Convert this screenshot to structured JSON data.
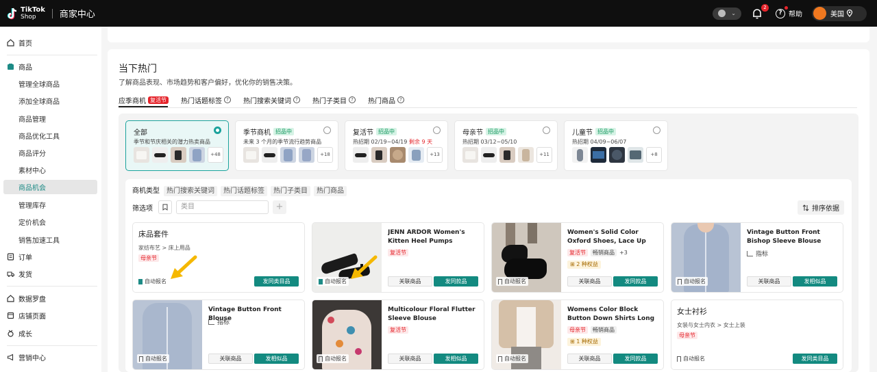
{
  "header": {
    "logo_line1": "TikTok",
    "logo_line2": "Shop",
    "title": "商家中心",
    "notification_count": "2",
    "help_label": "帮助",
    "region_label": "美国"
  },
  "sidebar": {
    "items": [
      {
        "label": "首页",
        "icon": "home-icon"
      },
      {
        "label": "商品",
        "icon": "product-icon"
      },
      {
        "label": "管理全球商品"
      },
      {
        "label": "添加全球商品"
      },
      {
        "label": "商品管理"
      },
      {
        "label": "商品优化工具"
      },
      {
        "label": "商品评分"
      },
      {
        "label": "素材中心"
      },
      {
        "label": "商品机会"
      },
      {
        "label": "管理库存"
      },
      {
        "label": "定价机会"
      },
      {
        "label": "销售加速工具"
      },
      {
        "label": "订单",
        "icon": "order-icon"
      },
      {
        "label": "发货",
        "icon": "truck-icon"
      },
      {
        "label": "数据罗盘",
        "icon": "compass-icon"
      },
      {
        "label": "店铺页面",
        "icon": "store-icon"
      },
      {
        "label": "成长",
        "icon": "growth-icon"
      },
      {
        "label": "营销中心",
        "icon": "megaphone-icon"
      }
    ]
  },
  "page": {
    "title": "当下热门",
    "subtitle": "了解商品表现、市场趋势和客户偏好，优化你的销售决策。",
    "tabs": [
      {
        "label": "应季商机",
        "badge": "复活节"
      },
      {
        "label": "热门话题标签"
      },
      {
        "label": "热门搜索关键词"
      },
      {
        "label": "热门子类目"
      },
      {
        "label": "热门商品"
      }
    ]
  },
  "seasons": [
    {
      "name": "全部",
      "tag": "",
      "desc": "季节和节庆相关的潜力热卖商品",
      "warn": "",
      "more": "+48",
      "selected": true
    },
    {
      "name": "季节商机",
      "tag": "招品中",
      "desc": "未来 3 个月的季节流行趋势商品",
      "warn": "",
      "more": "+18",
      "selected": false
    },
    {
      "name": "复活节",
      "tag": "招品中",
      "desc": "热招期 02/19~04/19",
      "warn": "剩余 9 天",
      "more": "+13",
      "selected": false
    },
    {
      "name": "母亲节",
      "tag": "招品中",
      "desc": "热招期 03/12~05/10",
      "warn": "",
      "more": "+11",
      "selected": false
    },
    {
      "name": "儿童节",
      "tag": "招品中",
      "desc": "热招期 04/09~06/07",
      "warn": "",
      "more": "+8",
      "selected": false
    }
  ],
  "filters": {
    "type_label": "商机类型",
    "types": [
      "热门搜索关键词",
      "热门话题标签",
      "热门子类目",
      "热门商品"
    ],
    "screen_label": "筛选项",
    "category_placeholder": "类目",
    "sort_label": "排序依据"
  },
  "products": [
    {
      "title": "床品套件",
      "category": "家纺布艺 > 床上用品",
      "tags": [
        "母亲节"
      ],
      "auto": "自动报名",
      "btn_primary": "发同类目品"
    },
    {
      "title": "JENN ARDOR Women's Kitten Heel Pumps Slingback Sand…",
      "tags": [
        "复活节"
      ],
      "auto": "自动报名",
      "btn_secondary": "关联商品",
      "btn_primary": "发同款品"
    },
    {
      "title": "Women's Solid Color Oxford Shoes, Lace Up Platform Cas…",
      "tags": [
        "复活节",
        "畅销商品"
      ],
      "more": "+3",
      "benefit": "2 种权益",
      "auto": "自动报名",
      "btn_secondary": "关联商品",
      "btn_primary": "发同款品"
    },
    {
      "title": "Vintage Button Front Bishop Sleeve Blouse",
      "metric": "指标",
      "auto": "自动报名",
      "btn_secondary": "关联商品",
      "btn_primary": "发相似品"
    },
    {
      "title": "Vintage Button Front Blouse",
      "metric": "指标",
      "auto": "自动报名",
      "btn_secondary": "关联商品",
      "btn_primary": "发相似品"
    },
    {
      "title": "Multicolour Floral Flutter Sleeve Blouse",
      "tags": [
        "复活节"
      ],
      "auto": "自动报名",
      "btn_secondary": "关联商品",
      "btn_primary": "发相似品"
    },
    {
      "title": "Womens Color Block Button Down Shirts Long Sleeve Line…",
      "tags": [
        "母亲节",
        "畅销商品"
      ],
      "benefit": "1 种权益",
      "auto": "自动报名",
      "btn_secondary": "关联商品",
      "btn_primary": "发同款品"
    },
    {
      "title": "女士衬衫",
      "category": "女装与女士内衣 > 女士上装",
      "tags": [
        "母亲节"
      ],
      "auto": "自动报名",
      "btn_primary": "发同类目品"
    }
  ],
  "colors": {
    "accent": "#138a80",
    "brand_dark": "#0f0f0f",
    "red": "#e5242b",
    "highlight_arrow": "#f5b800"
  }
}
